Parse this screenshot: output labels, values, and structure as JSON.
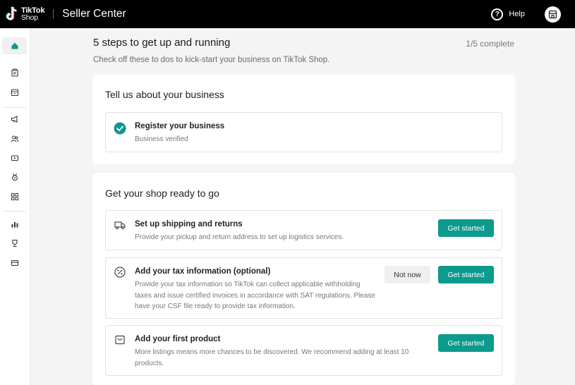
{
  "topbar": {
    "logo_line1": "TikTok",
    "logo_line2": "Shop",
    "app_title": "Seller Center",
    "help_label": "Help",
    "help_icon": "question-circle-icon",
    "avatar_icon": "store-icon"
  },
  "sidebar": {
    "items": [
      {
        "name": "home",
        "icon": "home-icon",
        "active": true
      },
      {
        "name": "orders",
        "icon": "clipboard-icon"
      },
      {
        "name": "products",
        "icon": "box-icon"
      },
      {
        "name": "marketing",
        "icon": "megaphone-icon"
      },
      {
        "name": "affiliate",
        "icon": "users-icon"
      },
      {
        "name": "live-video",
        "icon": "video-icon"
      },
      {
        "name": "rewards",
        "icon": "medal-icon"
      },
      {
        "name": "apps",
        "icon": "apps-grid-icon"
      },
      {
        "name": "analytics",
        "icon": "bar-chart-icon"
      },
      {
        "name": "achievements",
        "icon": "trophy-icon"
      },
      {
        "name": "finance",
        "icon": "card-icon"
      }
    ]
  },
  "header": {
    "title": "5 steps to get up and running",
    "progress": "1/5 complete",
    "subtitle": "Check off these to dos to kick-start your business on TikTok Shop."
  },
  "section1": {
    "title": "Tell us about your business",
    "steps": [
      {
        "title": "Register your business",
        "desc": "Business verified",
        "icon": "check-circle-icon",
        "complete": true
      }
    ]
  },
  "section2": {
    "title": "Get your shop ready to go",
    "steps": [
      {
        "title": "Set up shipping and returns",
        "desc": "Provide your pickup and return address to set up logistics services.",
        "icon": "truck-icon",
        "primary": "Get started"
      },
      {
        "title": "Add your tax information (optional)",
        "desc": "Provide your tax information so TikTok can collect applicable withholding taxes and issue certified invoices in accordance with SAT regulations. Please have your CSF file ready to provide tax information.",
        "icon": "percent-icon",
        "secondary": "Not now",
        "primary": "Get started"
      },
      {
        "title": "Add your first product",
        "desc": "More listings means more chances to be discovered. We recommend adding at least 10 products.",
        "icon": "bag-icon",
        "primary": "Get started"
      }
    ]
  },
  "colors": {
    "accent": "#0b9a8b",
    "topbar": "#000000",
    "background": "#f4f4f5"
  }
}
